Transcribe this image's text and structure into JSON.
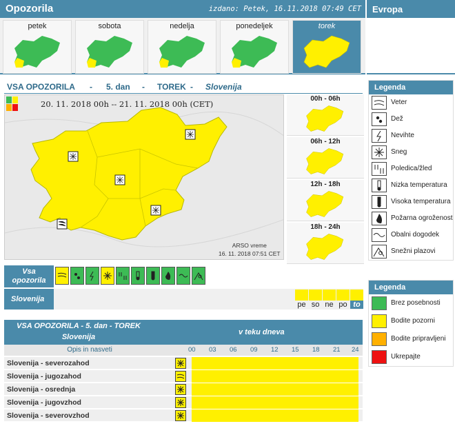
{
  "header": {
    "title": "Opozorila",
    "issued": "izdano: Petek, 16.11.2018 07:49 CET",
    "europe": "Evropa"
  },
  "days": [
    {
      "label": "petek",
      "color": "#3dbb55",
      "active": false
    },
    {
      "label": "sobota",
      "color": "#3dbb55",
      "active": false
    },
    {
      "label": "nedelja",
      "color": "#3dbb55",
      "active": false
    },
    {
      "label": "ponedeljek",
      "color": "#3dbb55",
      "active": false
    },
    {
      "label": "torek",
      "color": "#fff000",
      "active": true
    }
  ],
  "subhead": {
    "a": "VSA OPOZORILA",
    "dash1": "-",
    "b": "5. dan",
    "dash2": "-",
    "c": "TOREK",
    "dash3": "-",
    "d": "Slovenija"
  },
  "map": {
    "date_range": "20. 11. 2018 00h  --  21. 11. 2018 00h   (CET)",
    "source": "ARSO vreme",
    "source_time": "16. 11. 2018  07:51 CET"
  },
  "periods": [
    {
      "label": "00h - 06h"
    },
    {
      "label": "06h - 12h"
    },
    {
      "label": "12h - 18h"
    },
    {
      "label": "18h - 24h"
    }
  ],
  "type_row": {
    "label_line1": "Vsa",
    "label_line2": "opozorila",
    "icons": [
      "wind-icon",
      "rain-icon",
      "thunderstorm-icon",
      "snow-icon",
      "ice-icon",
      "low-temp-icon",
      "high-temp-icon",
      "fire-icon",
      "coastal-icon",
      "avalanche-icon"
    ]
  },
  "region_row": {
    "label": "Slovenija",
    "days": [
      "pe",
      "so",
      "ne",
      "po",
      "to"
    ]
  },
  "table": {
    "title": "VSA OPOZORILA - 5. dan - TOREK",
    "subtitle": "Slovenija",
    "during": "v teku dneva",
    "desc_header": "Opis in nasveti",
    "hours": [
      "00",
      "03",
      "06",
      "09",
      "12",
      "15",
      "18",
      "21",
      "24"
    ],
    "rows": [
      {
        "name": "Slovenija - severozahod",
        "icon": "snow-icon"
      },
      {
        "name": "Slovenija - jugozahod",
        "icon": "wind-icon"
      },
      {
        "name": "Slovenija - osrednja",
        "icon": "snow-icon"
      },
      {
        "name": "Slovenija - jugovzhod",
        "icon": "snow-icon"
      },
      {
        "name": "Slovenija - severovzhod",
        "icon": "snow-icon"
      }
    ]
  },
  "legend_types": {
    "title": "Legenda",
    "items": [
      {
        "label": "Veter",
        "icon": "wind-icon"
      },
      {
        "label": "Dež",
        "icon": "rain-icon"
      },
      {
        "label": "Nevihte",
        "icon": "thunderstorm-icon"
      },
      {
        "label": "Sneg",
        "icon": "snow-icon"
      },
      {
        "label": "Poledica/žled",
        "icon": "ice-icon"
      },
      {
        "label": "Nizka temperatura",
        "icon": "low-temp-icon"
      },
      {
        "label": "Visoka temperatura",
        "icon": "high-temp-icon"
      },
      {
        "label": "Požarna ogroženost",
        "icon": "fire-icon"
      },
      {
        "label": "Obalni dogodek",
        "icon": "coastal-icon"
      },
      {
        "label": "Snežni plazovi",
        "icon": "avalanche-icon"
      }
    ]
  },
  "legend_colors": {
    "title": "Legenda",
    "items": [
      {
        "label": "Brez posebnosti",
        "color": "#3dbb55"
      },
      {
        "label": "Bodite pozorni",
        "color": "#fff000"
      },
      {
        "label": "Bodite pripravljeni",
        "color": "#ffb000"
      },
      {
        "label": "Ukrepajte",
        "color": "#ee1111"
      }
    ]
  }
}
